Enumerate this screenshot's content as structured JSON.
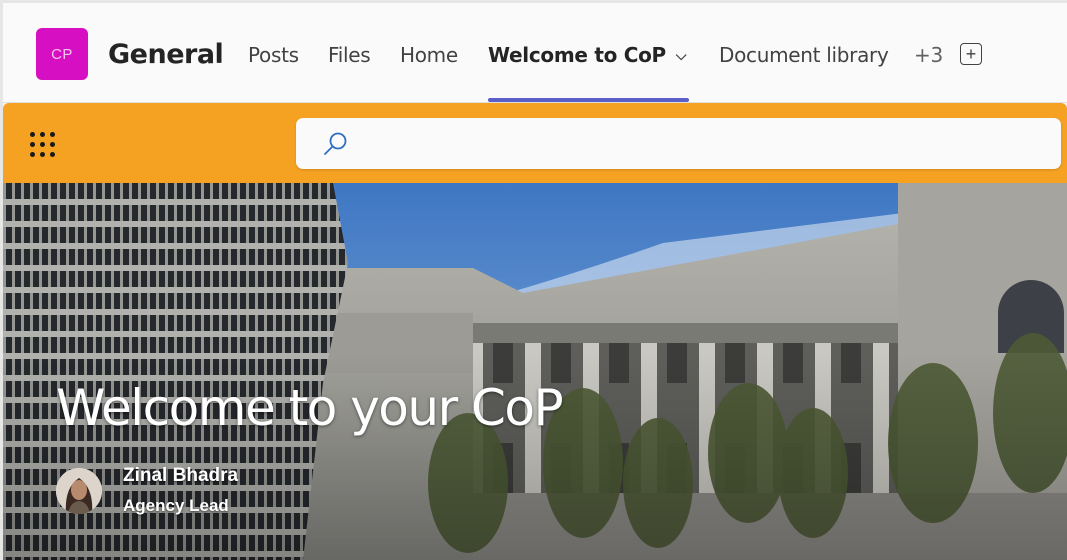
{
  "header": {
    "team_initials": "CP",
    "team_color": "#d60fc3",
    "channel_name": "General",
    "tabs": [
      {
        "label": "Posts",
        "active": false
      },
      {
        "label": "Files",
        "active": false
      },
      {
        "label": "Home",
        "active": false
      },
      {
        "label": "Welcome to CoP",
        "active": true,
        "has_dropdown": true
      },
      {
        "label": "Document library",
        "active": false
      }
    ],
    "overflow_label": "+3",
    "add_tab_icon": "plus-square-icon",
    "active_tab_color": "#5b5fc7"
  },
  "topbar": {
    "color": "#f5a122",
    "app_launcher_icon": "waffle-icon",
    "search": {
      "placeholder": "",
      "value": "",
      "icon": "search-icon"
    }
  },
  "hero": {
    "title": "Welcome to your CoP",
    "author": {
      "name": "Zinal Bhadra",
      "role": "Agency Lead"
    },
    "image_description": "Parliament buildings (Beehive and Parliament House) under blue sky"
  }
}
